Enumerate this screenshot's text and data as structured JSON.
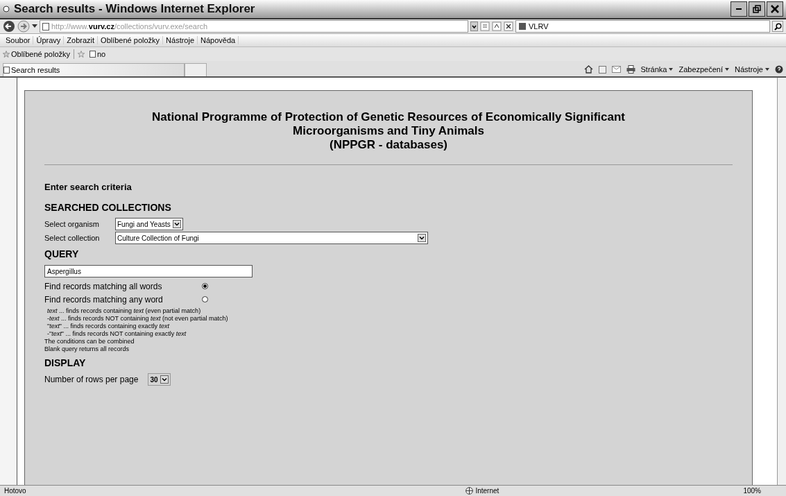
{
  "window": {
    "title": "Search results - Windows Internet Explorer"
  },
  "address_bar": {
    "url": "http://www.**vurv.cz**/collections/vurv.exe/search",
    "search_text": "VLRV"
  },
  "menu_bar": [
    "Soubor",
    "Úpravy",
    "Zobrazit",
    "Oblíbené položky",
    "Nástroje",
    "Nápověda"
  ],
  "favorites_bar": {
    "label": "Oblíbené položky",
    "items": [
      "no"
    ]
  },
  "tab": {
    "title": "Search results"
  },
  "command_bar": [
    "Stránka",
    "Zabezpečení",
    "Nástroje"
  ],
  "page": {
    "heading": [
      "National Programme of Protection of Genetic Resources of Economically Significant",
      "Microorganisms and Tiny Animals",
      "(NPPGR - databases)"
    ],
    "intro": "Enter search criteria",
    "sections": [
      {
        "title": "SEARCHED COLLECTIONS"
      },
      {
        "title": "QUERY"
      },
      {
        "title": "DISPLAY"
      }
    ],
    "selects": [
      {
        "label": "Select organism",
        "value": "Fungi and Yeasts",
        "wide": false
      },
      {
        "label": "Select collection",
        "value": "Culture Collection of Fungi",
        "wide": true
      }
    ],
    "query": {
      "value": "Aspergillus"
    },
    "match_options": [
      {
        "label": "Find records matching all words",
        "selected": true
      },
      {
        "label": "Find records matching any word",
        "selected": false
      }
    ],
    "hints": [
      "*text* ... finds records containing *text* (even partial match)",
      "-*text* ... finds records NOT containing *text* (not even partial match)",
      "\"*text*\" ... finds records containing exactly *text*",
      "-\"*text*\" ... finds records NOT containing exactly *text*",
      "The conditions can be combined",
      "Blank query returns all records"
    ],
    "rows_per_page": {
      "label": "Number of rows per page",
      "value": "30"
    }
  },
  "status_bar": {
    "status": "Hotovo",
    "zone": "Internet",
    "zoom": "100%"
  }
}
